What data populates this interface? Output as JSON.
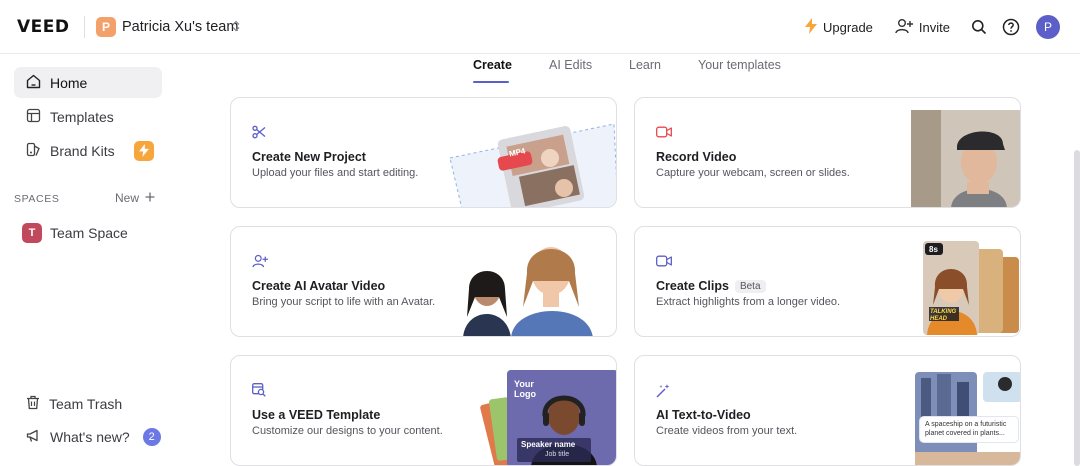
{
  "brand": {
    "logo": "VEED",
    "team_initial": "P",
    "team_name": "Patricia Xu's team"
  },
  "header": {
    "upgrade_label": "Upgrade",
    "invite_label": "Invite",
    "avatar_initial": "P"
  },
  "sidebar": {
    "items": [
      {
        "label": "Home",
        "icon": "home-icon",
        "active": true
      },
      {
        "label": "Templates",
        "icon": "templates-icon"
      },
      {
        "label": "Brand Kits",
        "icon": "brand-kit-icon"
      }
    ],
    "spaces_label": "SPACES",
    "new_label": "New",
    "space": {
      "initial": "T",
      "label": "Team Space"
    },
    "trash_label": "Team Trash",
    "whats_new_label": "What's new?",
    "whats_new_count": "2"
  },
  "tabs": [
    {
      "label": "Create",
      "active": true
    },
    {
      "label": "AI Edits"
    },
    {
      "label": "Learn"
    },
    {
      "label": "Your templates"
    }
  ],
  "cards": [
    {
      "title": "Create New Project",
      "subtitle": "Upload your files and start editing.",
      "icon": "scissors-icon",
      "thumb_badge": "MP4"
    },
    {
      "title": "Record Video",
      "subtitle": "Capture your webcam, screen or slides.",
      "icon": "record-camera-icon"
    },
    {
      "title": "Create AI Avatar Video",
      "subtitle": "Bring your script to life with an Avatar.",
      "icon": "user-plus-icon"
    },
    {
      "title": "Create Clips",
      "badge": "Beta",
      "subtitle": "Extract highlights from a longer video.",
      "icon": "video-icon",
      "thumb_badge": "8s",
      "thumb_caption": "TALKING HEAD"
    },
    {
      "title": "Use a VEED Template",
      "subtitle": "Customize our designs to your content.",
      "icon": "template-search-icon",
      "thumb_logo": "Your Logo",
      "thumb_name": "Speaker name",
      "thumb_job": "Job title"
    },
    {
      "title": "AI Text-to-Video",
      "subtitle": "Create videos from your text.",
      "icon": "magic-wand-icon",
      "thumb_prompt": "A spaceship on a futuristic planet covered in plants..."
    }
  ],
  "colors": {
    "accent": "#5b5fc7",
    "badge_orange": "#f7a63b",
    "record_red": "#e5484d"
  }
}
